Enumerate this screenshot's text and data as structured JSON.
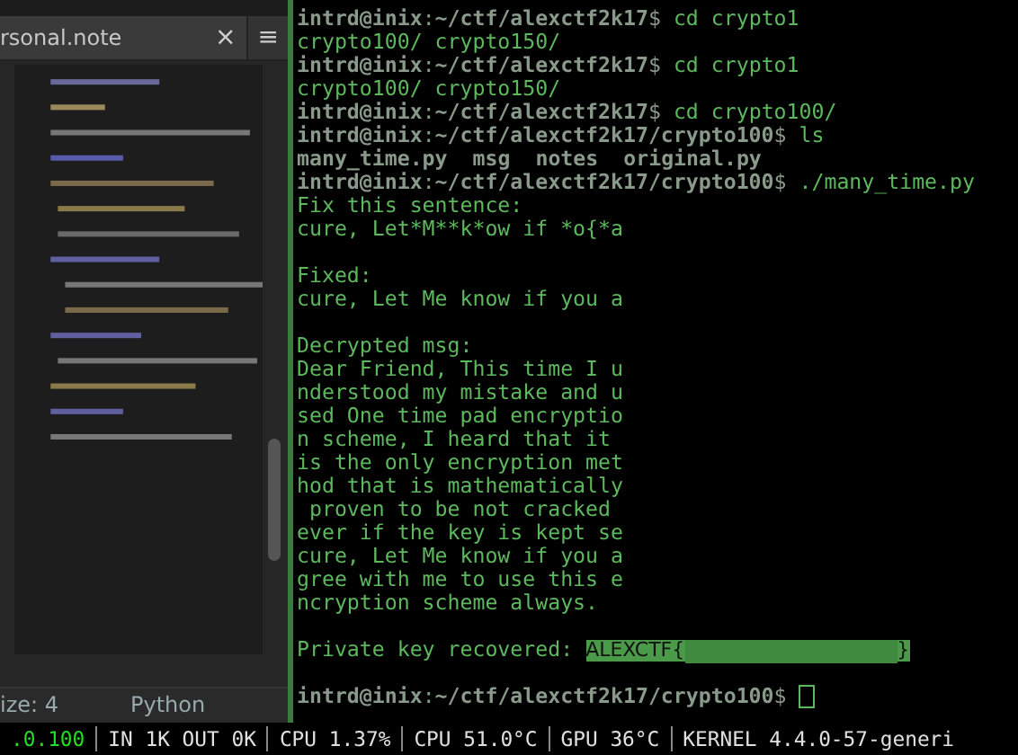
{
  "editor": {
    "tab_title": "rsonal.note",
    "close": "×",
    "menu": "≡",
    "status_left": "ize: 4",
    "status_right": "Python"
  },
  "terminal": {
    "lines": [
      {
        "kind": "prompt",
        "prompt": "**intrd@inix**:**~/ctf/alexctf2k17**$",
        "command": "cd crypto1"
      },
      {
        "kind": "output",
        "text": "crypto100/ crypto150/"
      },
      {
        "kind": "prompt",
        "prompt": "**intrd@inix**:**~/ctf/alexctf2k17**$",
        "command": "cd crypto1"
      },
      {
        "kind": "output",
        "text": "crypto100/ crypto150/"
      },
      {
        "kind": "prompt",
        "prompt": "**intrd@inix**:**~/ctf/alexctf2k17**$",
        "command": "cd crypto100/"
      },
      {
        "kind": "prompt",
        "prompt": "**intrd@inix**:**~/ctf/alexctf2k17/crypto100**$",
        "command": "ls"
      },
      {
        "kind": "listing",
        "items": [
          "many_time.py",
          "msg",
          "notes",
          "original.py"
        ]
      },
      {
        "kind": "prompt",
        "prompt": "**intrd@inix**:**~/ctf/alexctf2k17/crypto100**$",
        "command": "./many_time.py"
      },
      {
        "kind": "output",
        "text": "Fix this sentence:"
      },
      {
        "kind": "output",
        "text": "cure, Let*M**k*ow if *o{*a"
      },
      {
        "kind": "blank"
      },
      {
        "kind": "output",
        "text": "Fixed:"
      },
      {
        "kind": "output",
        "text": "cure, Let Me know if you a"
      },
      {
        "kind": "blank"
      },
      {
        "kind": "output",
        "text": "Decrypted msg:"
      },
      {
        "kind": "output",
        "text": "Dear Friend, This time I u"
      },
      {
        "kind": "output",
        "text": "nderstood my mistake and u"
      },
      {
        "kind": "output",
        "text": "sed One time pad encryptio"
      },
      {
        "kind": "output",
        "text": "n scheme, I heard that it"
      },
      {
        "kind": "output",
        "text": "is the only encryption met"
      },
      {
        "kind": "output",
        "text": "hod that is mathematically"
      },
      {
        "kind": "output",
        "text": " proven to be not cracked"
      },
      {
        "kind": "output",
        "text": "ever if the key is kept se"
      },
      {
        "kind": "output",
        "text": "cure, Let Me know if you a"
      },
      {
        "kind": "output",
        "text": "gree with me to use this e"
      },
      {
        "kind": "output",
        "text": "ncryption scheme always."
      },
      {
        "kind": "blank"
      },
      {
        "kind": "key",
        "label": "Private key recovered:",
        "prefix": "ALEXCTF{",
        "suffix": "}"
      },
      {
        "kind": "blank"
      },
      {
        "kind": "prompt",
        "prompt": "**intrd@inix**:**~/ctf/alexctf2k17/crypto100**$",
        "cursor": true
      }
    ]
  },
  "status_bar": [
    {
      "text": ".0.100",
      "color": "#22dd22"
    },
    {
      "text": "IN 1K OUT 0K",
      "color": "#e0e0e0"
    },
    {
      "text": "CPU 1.37%",
      "color": "#e0e0e0"
    },
    {
      "text": "CPU 51.0°C",
      "color": "#e0e0e0"
    },
    {
      "text": "GPU 36°C",
      "color": "#e0e0e0"
    },
    {
      "text": "KERNEL 4.4.0-57-generi",
      "color": "#e0e0e0"
    }
  ]
}
